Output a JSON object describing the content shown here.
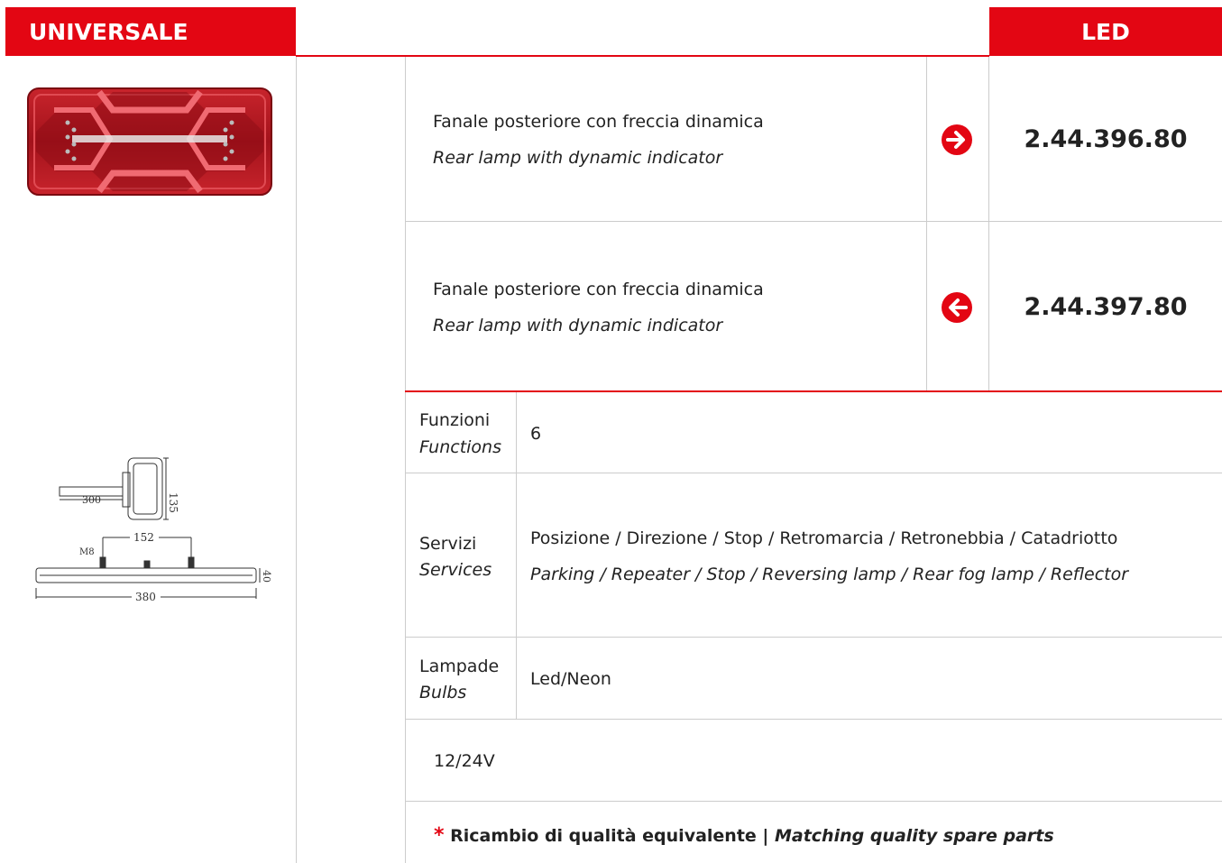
{
  "header": {
    "category": "UNIVERSALE",
    "type": "LED"
  },
  "products": [
    {
      "desc_it": "Fanale posteriore con freccia dinamica",
      "desc_en": "Rear lamp with dynamic indicator",
      "direction": "right",
      "code": "2.44.396.80"
    },
    {
      "desc_it": "Fanale posteriore con freccia dinamica",
      "desc_en": "Rear lamp with dynamic indicator",
      "direction": "left",
      "code": "2.44.397.80"
    }
  ],
  "specs": {
    "functions": {
      "label_it": "Funzioni",
      "label_en": "Functions",
      "value": "6"
    },
    "services": {
      "label_it": "Servizi",
      "label_en": "Services",
      "value_it": "Posizione / Direzione / Stop / Retromarcia / Retronebbia / Catadriotto",
      "value_en": "Parking / Repeater / Stop / Reversing lamp / Rear fog lamp / Reflector"
    },
    "bulbs": {
      "label_it": "Lampade",
      "label_en": "Bulbs",
      "value": "Led/Neon"
    },
    "voltage": "12/24V"
  },
  "drawing": {
    "dims": {
      "length": "300",
      "height": "135",
      "spacing": "152",
      "thread": "M8",
      "width": "380",
      "depth": "40"
    }
  },
  "footnote": {
    "star": "*",
    "text_it": "Ricambio di qualità equivalente | ",
    "text_en": "Matching quality spare parts"
  },
  "colors": {
    "accent": "#e30613",
    "grid": "#cccccc"
  },
  "icons": [
    "arrow-right-circle-icon",
    "arrow-left-circle-icon"
  ]
}
